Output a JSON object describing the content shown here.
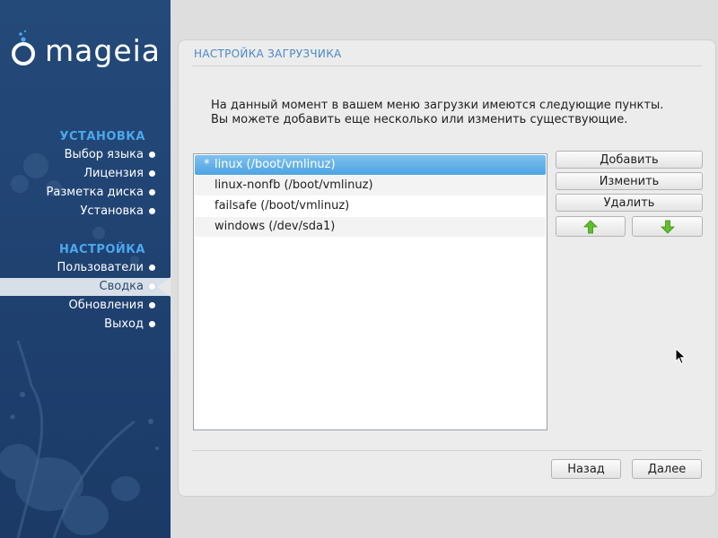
{
  "sidebar": {
    "logo_text": "mageia",
    "sections": [
      {
        "title": "УСТАНОВКА"
      },
      {
        "title": "НАСТРОЙКА"
      }
    ],
    "install_steps": [
      "Выбор языка",
      "Лицензия",
      "Разметка диска",
      "Установка"
    ],
    "config_steps": [
      "Пользователи",
      "Сводка",
      "Обновления",
      "Выход"
    ],
    "active_step": "Сводка"
  },
  "panel": {
    "title": "НАСТРОЙКА ЗАГРУЗЧИКА",
    "description": [
      "На данный момент в вашем меню загрузки имеются следующие пункты.",
      "Вы можете добавить еще несколько или изменить существующие."
    ],
    "entries": [
      {
        "marker": "*",
        "label": "linux (/boot/vmlinuz)",
        "selected": true
      },
      {
        "marker": "",
        "label": "linux-nonfb (/boot/vmlinuz)",
        "selected": false
      },
      {
        "marker": "",
        "label": "failsafe (/boot/vmlinuz)",
        "selected": false
      },
      {
        "marker": "",
        "label": "windows (/dev/sda1)",
        "selected": false
      }
    ],
    "buttons": {
      "add": "Добавить",
      "modify": "Изменить",
      "remove": "Удалить",
      "move_up_icon": "arrow-up-icon",
      "move_down_icon": "arrow-down-icon"
    },
    "footer": {
      "back": "Назад",
      "next": "Далее"
    }
  },
  "colors": {
    "sidebar_bg": "#1f4170",
    "section_title": "#4aa8ec",
    "panel_title": "#4a89c8",
    "selection": "#4da4e2",
    "arrow_green": "#5fbf2a"
  }
}
